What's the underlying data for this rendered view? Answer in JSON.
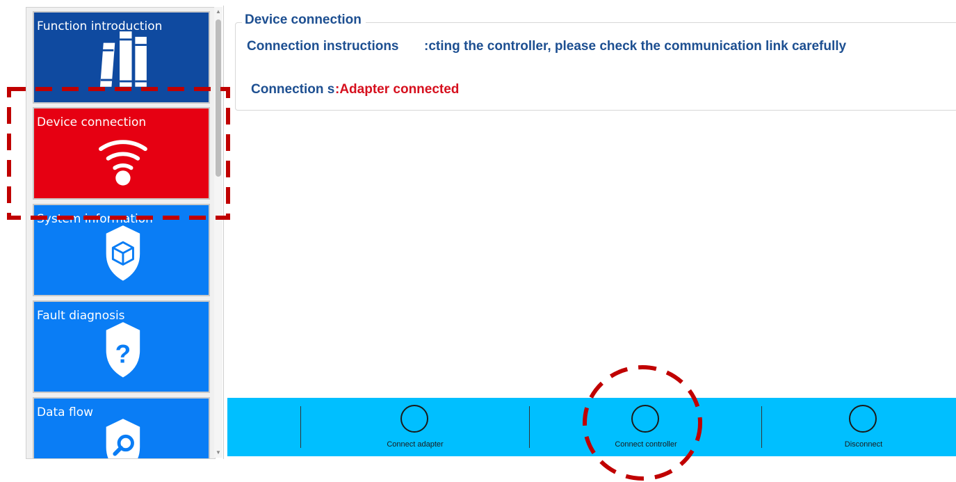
{
  "sidebar": {
    "items": [
      {
        "label": "Function introduction",
        "icon": "books-icon"
      },
      {
        "label": "Device connection",
        "icon": "wifi-icon"
      },
      {
        "label": "System information",
        "icon": "shield-cube-icon"
      },
      {
        "label": "Fault diagnosis",
        "icon": "shield-question-icon"
      },
      {
        "label": "Data flow",
        "icon": "shield-search-icon"
      }
    ],
    "selected": "Device connection"
  },
  "main": {
    "group_title": "Device connection",
    "instructions_label": "Connection instructions",
    "instructions_text": ":cting the controller, please check the communication link carefully",
    "connection_label": "Connection status",
    "connection_value": ":Adapter connected"
  },
  "toolbar": {
    "buttons": [
      {
        "label": "Connect adapter"
      },
      {
        "label": "Connect controller"
      },
      {
        "label": "Disconnect"
      }
    ]
  },
  "colors": {
    "selected_tile": "#e60012",
    "tile": "#0a7df5",
    "intro_tile": "#0f4aa0",
    "toolbar": "#00bfff",
    "heading_text": "#1d4f91",
    "status_text": "#d6101e",
    "annotation": "#c00000"
  }
}
